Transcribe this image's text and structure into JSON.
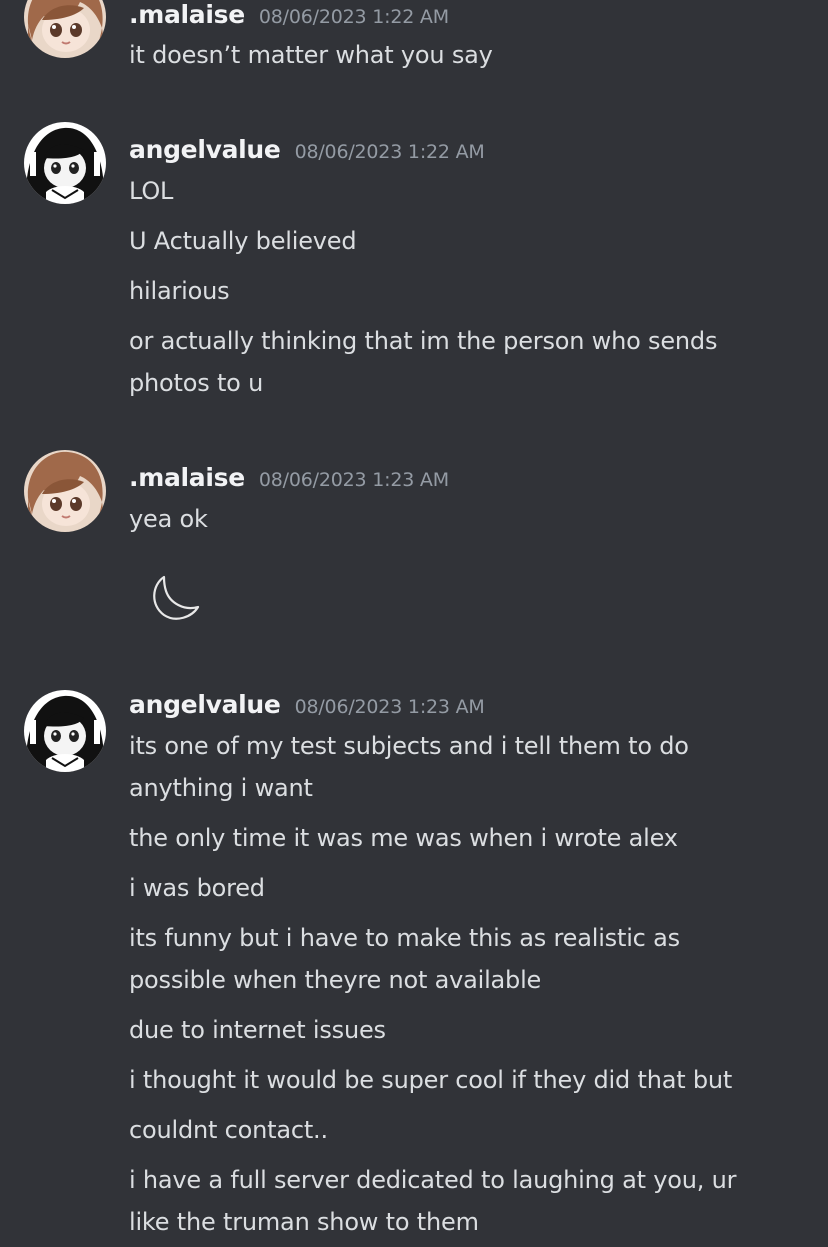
{
  "colors": {
    "background": "#313338",
    "text": "#dbdee1",
    "username": "#f2f3f5",
    "timestamp": "#949ba4"
  },
  "messages": [
    {
      "author": ".malaise",
      "avatar_icon": "anime-girl-brown-hair-avatar",
      "timestamp": "08/06/2023 1:22 AM",
      "lines": [
        "it doesn’t matter what you say"
      ]
    },
    {
      "author": "angelvalue",
      "avatar_icon": "anime-girl-black-hair-avatar",
      "timestamp": "08/06/2023 1:22 AM",
      "lines": [
        "LOL",
        "U Actually believed",
        "hilarious",
        "or actually thinking that im the person who sends",
        "photos to u"
      ]
    },
    {
      "author": ".malaise",
      "avatar_icon": "anime-girl-brown-hair-avatar",
      "timestamp": "08/06/2023 1:23 AM",
      "lines": [
        "yea ok"
      ],
      "attachment_icon": "crescent-moon-icon"
    },
    {
      "author": "angelvalue",
      "avatar_icon": "anime-girl-black-hair-avatar",
      "timestamp": "08/06/2023 1:23 AM",
      "lines": [
        "its one of my test subjects and i tell them to do",
        "anything i want",
        "the only time it was me was when i wrote alex",
        "i was bored",
        "its funny but i have to make this as realistic as",
        "possible when theyre not available",
        "due to internet issues",
        "i thought it would be super cool if they did that but",
        "couldnt contact..",
        "i have a full server dedicated to laughing at you, ur",
        "like the truman show to them"
      ]
    }
  ]
}
